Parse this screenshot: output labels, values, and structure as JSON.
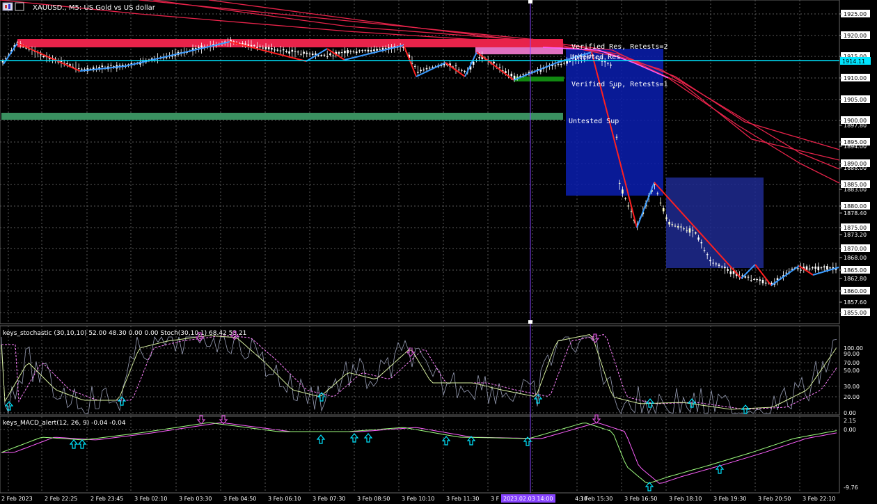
{
  "header": {
    "symbol": "XAUUSD.",
    "timeframe": "M5",
    "description": "US Gold vs US dollar",
    "title_text": "XAUUSD., M5:  US Gold vs US dollar",
    "icon": "chart-window-icon"
  },
  "colors": {
    "background": "#000000",
    "grid": "#5a5a5a",
    "bull": "#ffffff",
    "bear": "#ffffff",
    "resistance_zone": "#e8234a",
    "support_zone": "#2e8b57",
    "bid_line": "#00e5ff",
    "zigzag_down": "#ff2020",
    "zigzag_up": "#3a9bff",
    "stoch_main": "#d8f0a0",
    "stoch_signal": "#ff80ff",
    "macd_main": "#a0ff80",
    "macd_signal": "#ff60ff",
    "arrow_up": "#00e5ff",
    "arrow_down": "#d050d0",
    "box_fill": "#1a2a8a",
    "crosshair": "#8844ff"
  },
  "price_axis": {
    "ticks": [
      "1925.00",
      "1920.00",
      "1915.00",
      "1910.00",
      "1905.00",
      "1900.00",
      "1897.80",
      "1895.00",
      "1894.00",
      "1890.00",
      "1888.00",
      "1885.00",
      "1883.00",
      "1880.00",
      "1878.40",
      "1875.00",
      "1873.20",
      "1870.00",
      "1868.00",
      "1865.00",
      "1862.80",
      "1860.00",
      "1857.60",
      "1855.00"
    ],
    "current_price": "1914.11"
  },
  "zones": {
    "verified_res_label": "Verified Res, Retests=2",
    "untested_res_label": "Untested Res",
    "verified_sup_label": "Verified Sup, Retests=1",
    "untested_sup_label": "Untested Sup"
  },
  "stochastic": {
    "label": "keys_stochastic (30,10,10) 52.00 48.30 0.00 0.00 Stoch(30,10,1) 68.42 53.21",
    "ticks": [
      "100.00",
      "90.00",
      "70.00",
      "50.00",
      "30.00",
      "20.00",
      "0.00"
    ]
  },
  "macd": {
    "label": "keys_MACD_alert(12, 26, 9) -0.04 -0.04",
    "ticks": [
      "2.15",
      "0.00",
      "-9.76"
    ]
  },
  "time_axis": {
    "labels": [
      "2 Feb 2023",
      "2 Feb 22:25",
      "2 Feb 23:45",
      "3 Feb 02:10",
      "3 Feb 03:30",
      "3 Feb 04:50",
      "3 Feb 06:10",
      "3 Feb 07:30",
      "3 Feb 08:50",
      "3 Feb 10:10",
      "3 Feb 11:30",
      "3 F",
      "4:10",
      "3 Feb 15:30",
      "3 Feb 16:50",
      "3 Feb 18:10",
      "3 Feb 19:30",
      "3 Feb 20:50",
      "3 Feb 22:10"
    ],
    "crosshair_time": "2023.02.03 14:00"
  }
}
